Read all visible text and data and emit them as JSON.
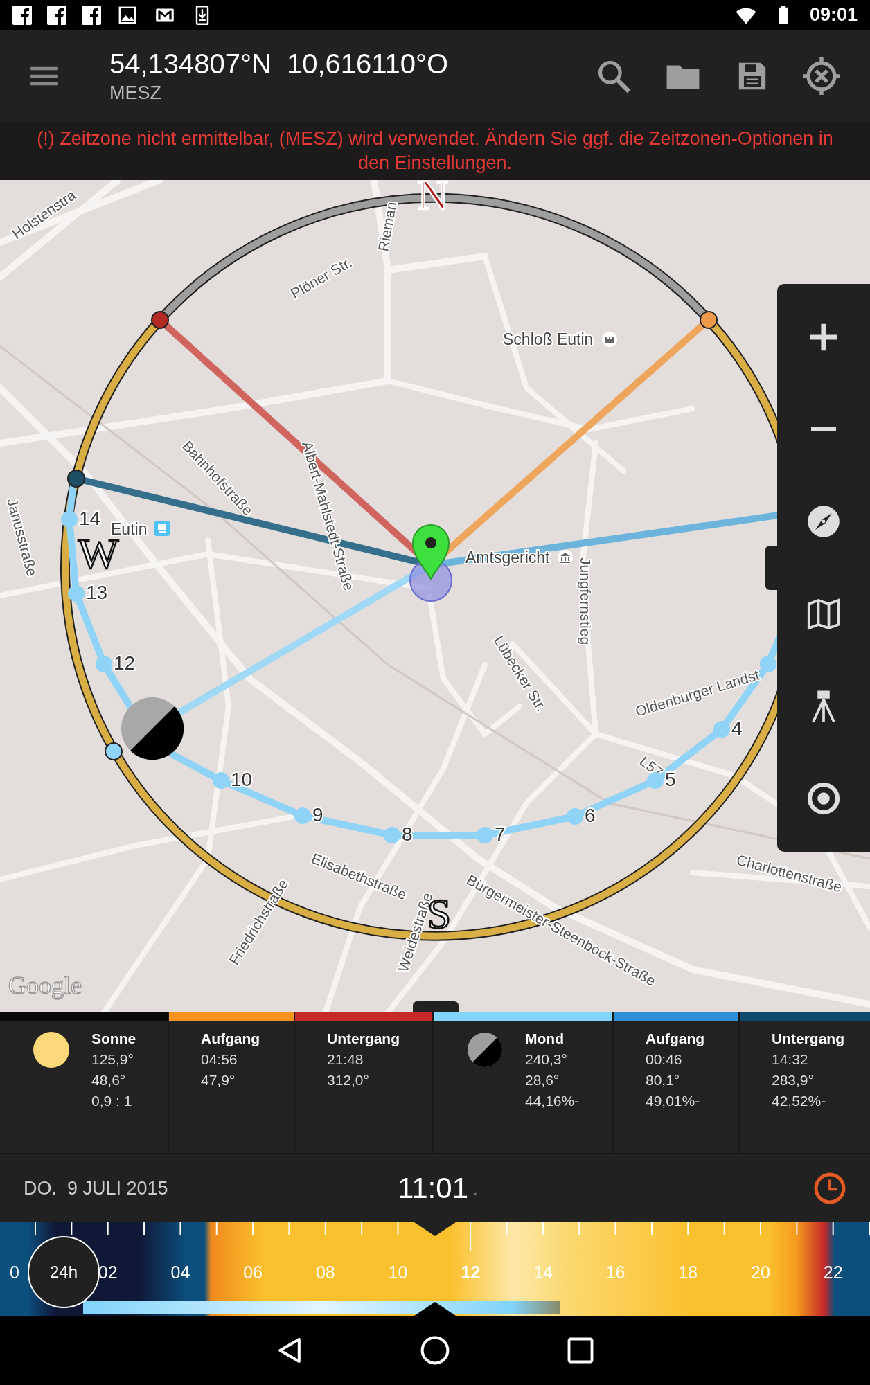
{
  "status_bar": {
    "time": "09:01"
  },
  "app_bar": {
    "latitude": "54,134807°N",
    "longitude": "10,616110°O",
    "timezone": "MESZ"
  },
  "warning": "(!) Zeitzone nicht ermittelbar, (MESZ) wird verwendet. Ändern Sie ggf. die Zeitzonen-Optionen in den Einstellungen.",
  "map": {
    "compass": [
      {
        "label": "N",
        "kind": "north"
      },
      {
        "label": "W",
        "kind": "plain"
      },
      {
        "label": "S",
        "kind": "plain"
      }
    ],
    "streets": [
      "Holstenstra",
      "Rieman",
      "Plöner Str.",
      "Bahnhofstraße",
      "Janusstraße",
      "Albert-Mahlstedt-Straße",
      "Jungfernstieg",
      "Lübecker Str.",
      "Oldenburger Landst",
      "L57",
      "Elisabethstraße",
      "Charlottenstraße",
      "Friedrichstraße",
      "Weidestraße",
      "Bürgermeister-Steenbock-Straße"
    ],
    "places": [
      {
        "label": "Schloß Eutin",
        "kind": "castle"
      },
      {
        "label": "Eutin",
        "kind": "station"
      },
      {
        "label": "Amtsgericht",
        "kind": "court"
      }
    ],
    "hour_marks": [
      "14",
      "13",
      "12",
      "10",
      "9",
      "8",
      "7",
      "6",
      "5",
      "4"
    ],
    "attribution": "Google"
  },
  "ephemeris": [
    {
      "kind": "sun",
      "color": "#0a0a0a",
      "title": "Sonne",
      "lines": [
        "125,9°",
        "48,6°",
        "0,9 : 1"
      ]
    },
    {
      "kind": "event",
      "color": "#f7931e",
      "title": "Aufgang",
      "lines": [
        "04:56",
        "47,9°"
      ]
    },
    {
      "kind": "event",
      "color": "#c62828",
      "title": "Untergang",
      "lines": [
        "21:48",
        "312,0°"
      ]
    },
    {
      "kind": "moon",
      "color": "#81d4fa",
      "title": "Mond",
      "lines": [
        "240,3°",
        "28,6°",
        "44,16%-"
      ]
    },
    {
      "kind": "event",
      "color": "#2d8fd5",
      "title": "Aufgang",
      "lines": [
        "00:46",
        "80,1°",
        "49,01%-"
      ]
    },
    {
      "kind": "event",
      "color": "#0d4a6e",
      "title": "Untergang",
      "lines": [
        "14:32",
        "283,9°",
        "42,52%-"
      ]
    }
  ],
  "date_bar": {
    "date": "DO.  9 JULI 2015",
    "time": "11:01",
    "seconds_mark": "."
  },
  "timeline": {
    "button": "24h",
    "hours": [
      {
        "label": "0",
        "current": false
      },
      {
        "label": "02",
        "current": false
      },
      {
        "label": "04",
        "current": false
      },
      {
        "label": "06",
        "current": false
      },
      {
        "label": "08",
        "current": false
      },
      {
        "label": "10",
        "current": false
      },
      {
        "label": "12",
        "current": true
      },
      {
        "label": "14",
        "current": false
      },
      {
        "label": "16",
        "current": false
      },
      {
        "label": "18",
        "current": false
      },
      {
        "label": "20",
        "current": false
      },
      {
        "label": "22",
        "current": false
      }
    ]
  }
}
